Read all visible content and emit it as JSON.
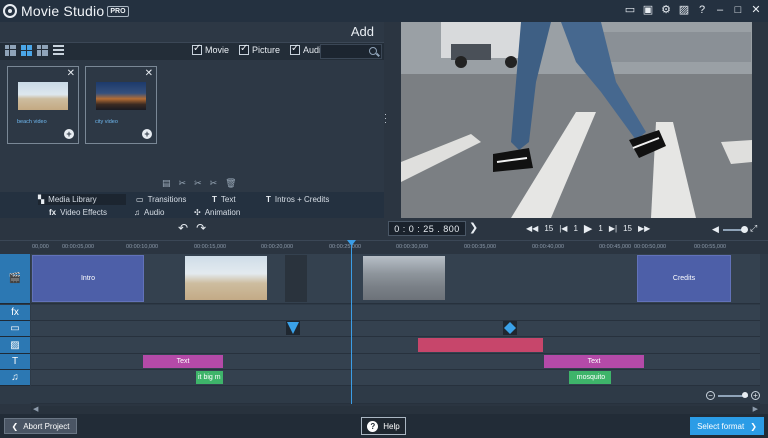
{
  "app": {
    "title": "Movie Studio",
    "badge": "PRO",
    "window_icons": [
      "chat-icon",
      "monitor-icon",
      "gear-icon",
      "image-icon",
      "help-icon",
      "minimize-icon",
      "maximize-icon",
      "close-icon"
    ]
  },
  "media_panel": {
    "add_label": "Add",
    "filters": [
      {
        "label": "Movie",
        "checked": true
      },
      {
        "label": "Picture",
        "checked": true
      },
      {
        "label": "Audio",
        "checked": true
      }
    ],
    "search_placeholder": "",
    "items": [
      {
        "label": "beach video"
      },
      {
        "label": "city video"
      }
    ],
    "tabs": [
      {
        "label": "Media Library",
        "icon": "media-library-icon",
        "active": true
      },
      {
        "label": "Transitions",
        "icon": "transitions-icon",
        "active": false
      },
      {
        "label": "Text",
        "icon": "text-icon",
        "active": false
      },
      {
        "label": "Intros + Credits",
        "icon": "intros-icon",
        "active": false
      },
      {
        "label": "Video Effects",
        "icon": "fx-icon",
        "active": false
      },
      {
        "label": "Audio",
        "icon": "audio-icon",
        "active": false
      },
      {
        "label": "Animation",
        "icon": "animation-icon",
        "active": false
      }
    ]
  },
  "transport": {
    "timecode": "0 : 0 : 25 . 800",
    "step_back": "15",
    "frame_back": "1",
    "frame_forward": "1",
    "step_forward": "15"
  },
  "ruler": {
    "ticks": [
      "00,000",
      "00:00:05,000",
      "00:00:10,000",
      "00:00:15,000",
      "00:00:20,000",
      "00:00:25,000",
      "00:00:30,000",
      "00:00:35,000",
      "00:00:40,000",
      "00:00:45,000",
      "00:00:50,000",
      "00:00:55,000"
    ]
  },
  "timeline": {
    "video_clips": {
      "intro": "Intro",
      "credits": "Credits"
    },
    "text_clips": [
      "Text",
      "Text"
    ],
    "audio_clips": [
      "it big m",
      "mosquito"
    ]
  },
  "bottom": {
    "abort": "Abort Project",
    "help": "Help",
    "select_format": "Select format"
  },
  "colors": {
    "accent": "#2b9ce6",
    "track_header": "#2c78b3",
    "title_clip": "#4d5fa8",
    "text_clip": "#b44aa8",
    "image_clip": "#c7466b",
    "audio_clip": "#3eb46a"
  }
}
